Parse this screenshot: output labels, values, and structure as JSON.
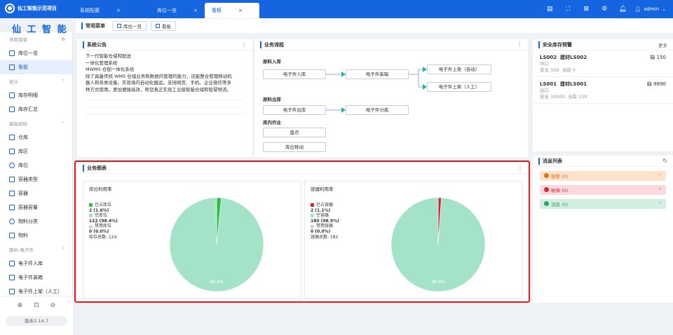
{
  "app": {
    "title": "仙工智能示范项目",
    "brand": "仙 工 智 能"
  },
  "tabs": [
    {
      "label": "系统配置",
      "close": "×"
    },
    {
      "label": "库位一览",
      "close": "×"
    },
    {
      "label": "看板",
      "close": "×"
    }
  ],
  "user": {
    "name": "admin"
  },
  "sidebar": {
    "group_common": "常用菜单",
    "common_items": [
      "库位一览",
      "看板"
    ],
    "group_stats": "统计",
    "stats_items": [
      "库存明细",
      "库存汇总"
    ],
    "group_base": "基础资料",
    "base_items": [
      "仓库",
      "库区",
      "库位",
      "容器类型",
      "容器",
      "容器容量",
      "物料分类",
      "物料"
    ],
    "group_inbound": "原料-电子件",
    "inbound_items": [
      "电子件入库",
      "电子件装箱",
      "电子件上架（人工）"
    ],
    "version": "版本2.14.7"
  },
  "quick": {
    "label": "常用菜单",
    "buttons": [
      "库位一览",
      "看板"
    ]
  },
  "notice": {
    "title": "系统公告",
    "lines": [
      "下一代智能仓储和配送",
      "一体化管理系统",
      "MWMS 仓配一体化系统",
      "除了具备传统 WMS 仓储业务和数据的管理的能力，还能整合管理移动机",
      "器人和各类设备，实现场内自动化搬运。支持网页、手机、企业微信等多",
      "种方式使用。更加便捷高效，帮您真正实现工业级智能仓储和智慧物流。"
    ]
  },
  "flow": {
    "title": "业务流程",
    "sec_in": "原料入库",
    "sec_out": "原料出库",
    "sec_inner": "库内作业",
    "b_in": "电子件入库",
    "b_pack": "电子件装箱",
    "b_shelf_auto": "电子件上架（自动）",
    "b_shelf_manual": "电子件上架（人工）",
    "b_out": "电子件出库",
    "b_sort": "电子件分拣",
    "b_count": "盘点",
    "b_move": "库位移动"
  },
  "stock": {
    "title": "安全库存预警",
    "more": "更多",
    "items": [
      {
        "code": "LS002",
        "name": "建材LS002",
        "shortage": "缺 150",
        "location": "中口",
        "safe": "安全 150",
        "current": "当前 0"
      },
      {
        "code": "LS001",
        "name": "建材LS001",
        "shortage": "缺 9890",
        "location": "出口",
        "safe": "安全 10000",
        "current": "当前 110"
      }
    ]
  },
  "messages": {
    "title": "消息列表",
    "items": [
      {
        "label": "報警",
        "count": "(0)"
      },
      {
        "label": "故障",
        "count": "(0)"
      },
      {
        "label": "消息",
        "count": "(0)"
      }
    ]
  },
  "business_chart": {
    "title": "业务图表"
  },
  "chart_data": [
    {
      "type": "pie",
      "title": "库位利用率",
      "categories": [
        "已占库位",
        "空库位",
        "禁用库位"
      ],
      "values": [
        2,
        122,
        0
      ],
      "labels": [
        "2 (1.6%)",
        "122 (98.4%)",
        "0 (0.0%)"
      ],
      "total_label": "库位总数: 124",
      "slice_label": "98.4%",
      "colors": [
        "#2cc13f",
        "#a5e3c9",
        "#cfd3da"
      ]
    },
    {
      "type": "pie",
      "title": "容器利用率",
      "categories": [
        "已占容器",
        "空容器",
        "禁用容器"
      ],
      "values": [
        2,
        180,
        0
      ],
      "labels": [
        "2 (1.1%)",
        "180 (98.9%)",
        "0 (0.0%)"
      ],
      "total_label": "容器总数: 182",
      "slice_label": "98.9%",
      "colors": [
        "#d4242f",
        "#a5e3c9",
        "#cfd3da"
      ]
    }
  ]
}
